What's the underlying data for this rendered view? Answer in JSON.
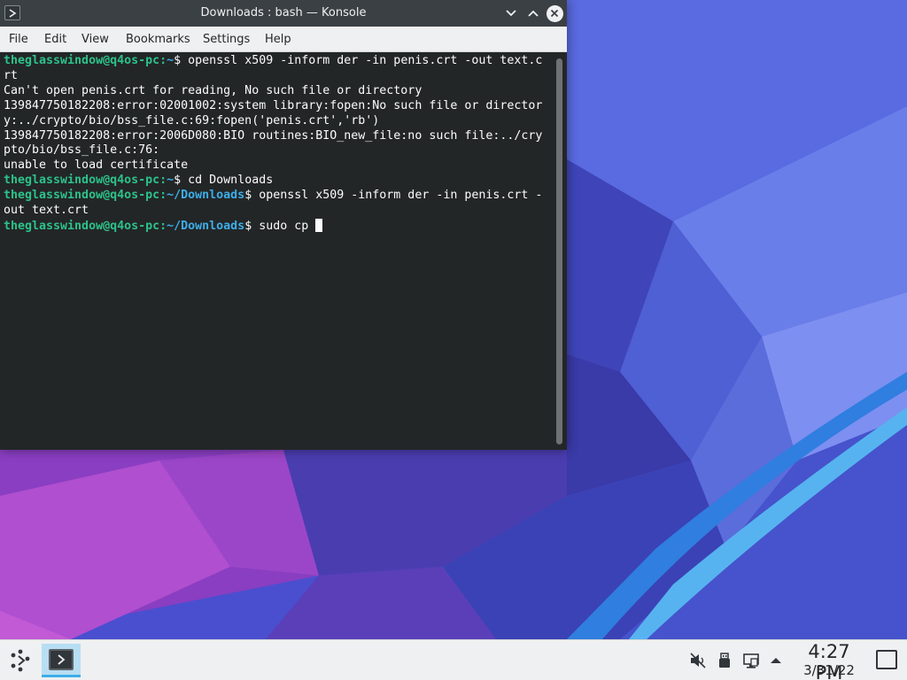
{
  "window": {
    "title": "Downloads : bash — Konsole"
  },
  "menu": [
    {
      "label": "File"
    },
    {
      "label": "Edit"
    },
    {
      "label": "View"
    },
    {
      "label": "Bookmarks"
    },
    {
      "label": "Settings"
    },
    {
      "label": "Help"
    }
  ],
  "terminal": {
    "user": "theglasswindow@q4os-pc",
    "sep": ":",
    "lines": [
      {
        "path": "~",
        "cmd": "$ openssl x509 -inform der -in penis.crt -out text.c"
      },
      {
        "text": "rt"
      },
      {
        "text": "Can't open penis.crt for reading, No such file or directory"
      },
      {
        "text": "139847750182208:error:02001002:system library:fopen:No such file or director"
      },
      {
        "text": "y:../crypto/bio/bss_file.c:69:fopen('penis.crt','rb')"
      },
      {
        "text": "139847750182208:error:2006D080:BIO routines:BIO_new_file:no such file:../cry"
      },
      {
        "text": "pto/bio/bss_file.c:76:"
      },
      {
        "text": "unable to load certificate"
      },
      {
        "path": "~",
        "cmd": "$ cd Downloads"
      },
      {
        "path": "~/Downloads",
        "cmd": "$ openssl x509 -inform der -in penis.crt -"
      },
      {
        "text": "out text.crt"
      },
      {
        "path": "~/Downloads",
        "cmd": "$ sudo cp "
      }
    ]
  },
  "taskbar": {
    "time": "4:27 PM",
    "date": "3/31/22",
    "tray_icons": [
      "speaker-muted-icon",
      "usb-drive-icon",
      "network-icon",
      "tray-expand-arrow-icon"
    ]
  },
  "colors": {
    "terminal_bg": "#232627",
    "prompt_user": "#2cc28b",
    "prompt_path": "#3daee9",
    "accent": "#3daee9"
  }
}
